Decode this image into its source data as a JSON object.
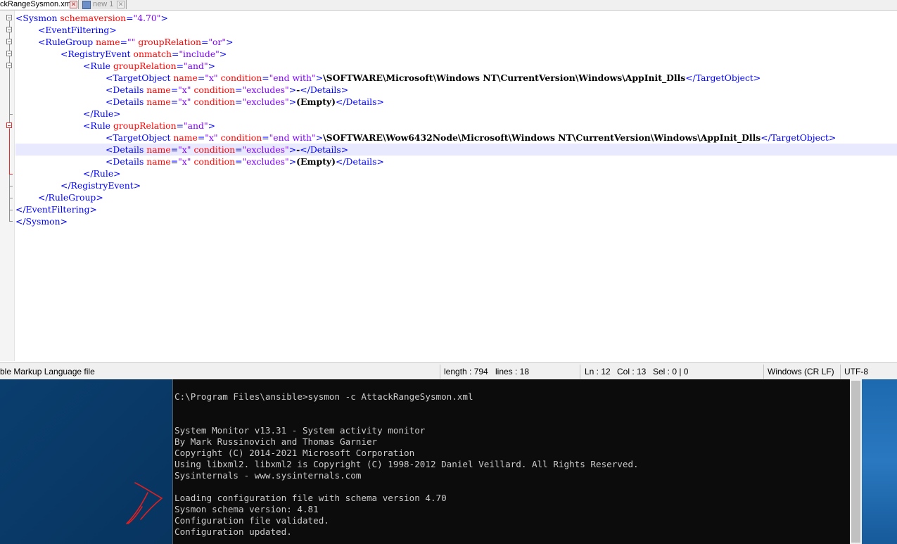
{
  "tabs": [
    {
      "label": "ckRangeSysmon.xml",
      "active": true
    },
    {
      "label": "new 1",
      "active": false
    }
  ],
  "editor": {
    "current_line": 12,
    "lines": [
      [
        [
          "t",
          "<Sysmon "
        ],
        [
          "a",
          "schemaversion"
        ],
        [
          "t",
          "="
        ],
        [
          "v",
          "\"4.70\""
        ],
        [
          "t",
          ">"
        ]
      ],
      [
        [
          "t",
          "<EventFiltering>"
        ]
      ],
      [
        [
          "t",
          "<RuleGroup "
        ],
        [
          "a",
          "name"
        ],
        [
          "t",
          "="
        ],
        [
          "v",
          "\"\""
        ],
        [
          "t",
          " "
        ],
        [
          "a",
          "groupRelation"
        ],
        [
          "t",
          "="
        ],
        [
          "v",
          "\"or\""
        ],
        [
          "t",
          ">"
        ]
      ],
      [
        [
          "t",
          "<RegistryEvent "
        ],
        [
          "a",
          "onmatch"
        ],
        [
          "t",
          "="
        ],
        [
          "v",
          "\"include\""
        ],
        [
          "t",
          ">"
        ]
      ],
      [
        [
          "t",
          "<Rule "
        ],
        [
          "a",
          "groupRelation"
        ],
        [
          "t",
          "="
        ],
        [
          "v",
          "\"and\""
        ],
        [
          "t",
          ">"
        ]
      ],
      [
        [
          "t",
          "<TargetObject "
        ],
        [
          "a",
          "name"
        ],
        [
          "t",
          "="
        ],
        [
          "v",
          "\"x\""
        ],
        [
          "t",
          " "
        ],
        [
          "a",
          "condition"
        ],
        [
          "t",
          "="
        ],
        [
          "v",
          "\"end with\""
        ],
        [
          "t",
          ">"
        ],
        [
          "x",
          "\\SOFTWARE\\Microsoft\\Windows NT\\CurrentVersion\\Windows\\AppInit_Dlls"
        ],
        [
          "t",
          "</TargetObject>"
        ]
      ],
      [
        [
          "t",
          "<Details "
        ],
        [
          "a",
          "name"
        ],
        [
          "t",
          "="
        ],
        [
          "v",
          "\"x\""
        ],
        [
          "t",
          " "
        ],
        [
          "a",
          "condition"
        ],
        [
          "t",
          "="
        ],
        [
          "v",
          "\"excludes\""
        ],
        [
          "t",
          ">"
        ],
        [
          "x",
          "-"
        ],
        [
          "t",
          "</Details>"
        ]
      ],
      [
        [
          "t",
          "<Details "
        ],
        [
          "a",
          "name"
        ],
        [
          "t",
          "="
        ],
        [
          "v",
          "\"x\""
        ],
        [
          "t",
          " "
        ],
        [
          "a",
          "condition"
        ],
        [
          "t",
          "="
        ],
        [
          "v",
          "\"excludes\""
        ],
        [
          "t",
          ">"
        ],
        [
          "x",
          "(Empty)"
        ],
        [
          "t",
          "</Details>"
        ]
      ],
      [
        [
          "t",
          "</Rule>"
        ]
      ],
      [
        [
          "t",
          "<Rule "
        ],
        [
          "a",
          "groupRelation"
        ],
        [
          "t",
          "="
        ],
        [
          "v",
          "\"and\""
        ],
        [
          "t",
          ">"
        ]
      ],
      [
        [
          "t",
          "<TargetObject "
        ],
        [
          "a",
          "name"
        ],
        [
          "t",
          "="
        ],
        [
          "v",
          "\"x\""
        ],
        [
          "t",
          " "
        ],
        [
          "a",
          "condition"
        ],
        [
          "t",
          "="
        ],
        [
          "v",
          "\"end with\""
        ],
        [
          "t",
          ">"
        ],
        [
          "x",
          "\\SOFTWARE\\Wow6432Node\\Microsoft\\Windows NT\\CurrentVersion\\Windows\\AppInit_Dlls"
        ],
        [
          "t",
          "</TargetObject>"
        ]
      ],
      [
        [
          "t",
          "<Details "
        ],
        [
          "a",
          "name"
        ],
        [
          "t",
          "="
        ],
        [
          "v",
          "\"x\""
        ],
        [
          "t",
          " "
        ],
        [
          "a",
          "condition"
        ],
        [
          "t",
          "="
        ],
        [
          "v",
          "\"excludes\""
        ],
        [
          "t",
          ">"
        ],
        [
          "x",
          "-"
        ],
        [
          "t",
          "</Details>"
        ]
      ],
      [
        [
          "t",
          "<Details "
        ],
        [
          "a",
          "name"
        ],
        [
          "t",
          "="
        ],
        [
          "v",
          "\"x\""
        ],
        [
          "t",
          " "
        ],
        [
          "a",
          "condition"
        ],
        [
          "t",
          "="
        ],
        [
          "v",
          "\"excludes\""
        ],
        [
          "t",
          ">"
        ],
        [
          "x",
          "(Empty)"
        ],
        [
          "t",
          "</Details>"
        ]
      ],
      [
        [
          "t",
          "</Rule>"
        ]
      ],
      [
        [
          "t",
          "</RegistryEvent>"
        ]
      ],
      [
        [
          "t",
          "</RuleGroup>"
        ]
      ],
      [
        [
          "t",
          "</EventFiltering>"
        ]
      ],
      [
        [
          "t",
          "</Sysmon>"
        ]
      ]
    ],
    "indent_levels": [
      0,
      1,
      1,
      2,
      3,
      4,
      4,
      4,
      3,
      3,
      4,
      4,
      4,
      3,
      2,
      1,
      0,
      0
    ]
  },
  "statusbar": {
    "file_type": "ble Markup Language file",
    "length": "length : 794",
    "lines": "lines : 18",
    "ln": "Ln : 12",
    "col": "Col : 13",
    "sel": "Sel : 0 | 0",
    "eol": "Windows (CR LF)",
    "encoding": "UTF-8"
  },
  "console": {
    "lines": [
      "C:\\Program Files\\ansible>sysmon -c AttackRangeSysmon.xml",
      "",
      "",
      "System Monitor v13.31 - System activity monitor",
      "By Mark Russinovich and Thomas Garnier",
      "Copyright (C) 2014-2021 Microsoft Corporation",
      "Using libxml2. libxml2 is Copyright (C) 1998-2012 Daniel Veillard. All Rights Reserved.",
      "Sysinternals - www.sysinternals.com",
      "",
      "Loading configuration file with schema version 4.70",
      "Sysmon schema version: 4.81",
      "Configuration file validated.",
      "Configuration updated."
    ]
  },
  "colors": {
    "tag": "#0000ff",
    "attribute": "#ff0000",
    "value": "#8000ff",
    "annotation": "#e02020"
  }
}
